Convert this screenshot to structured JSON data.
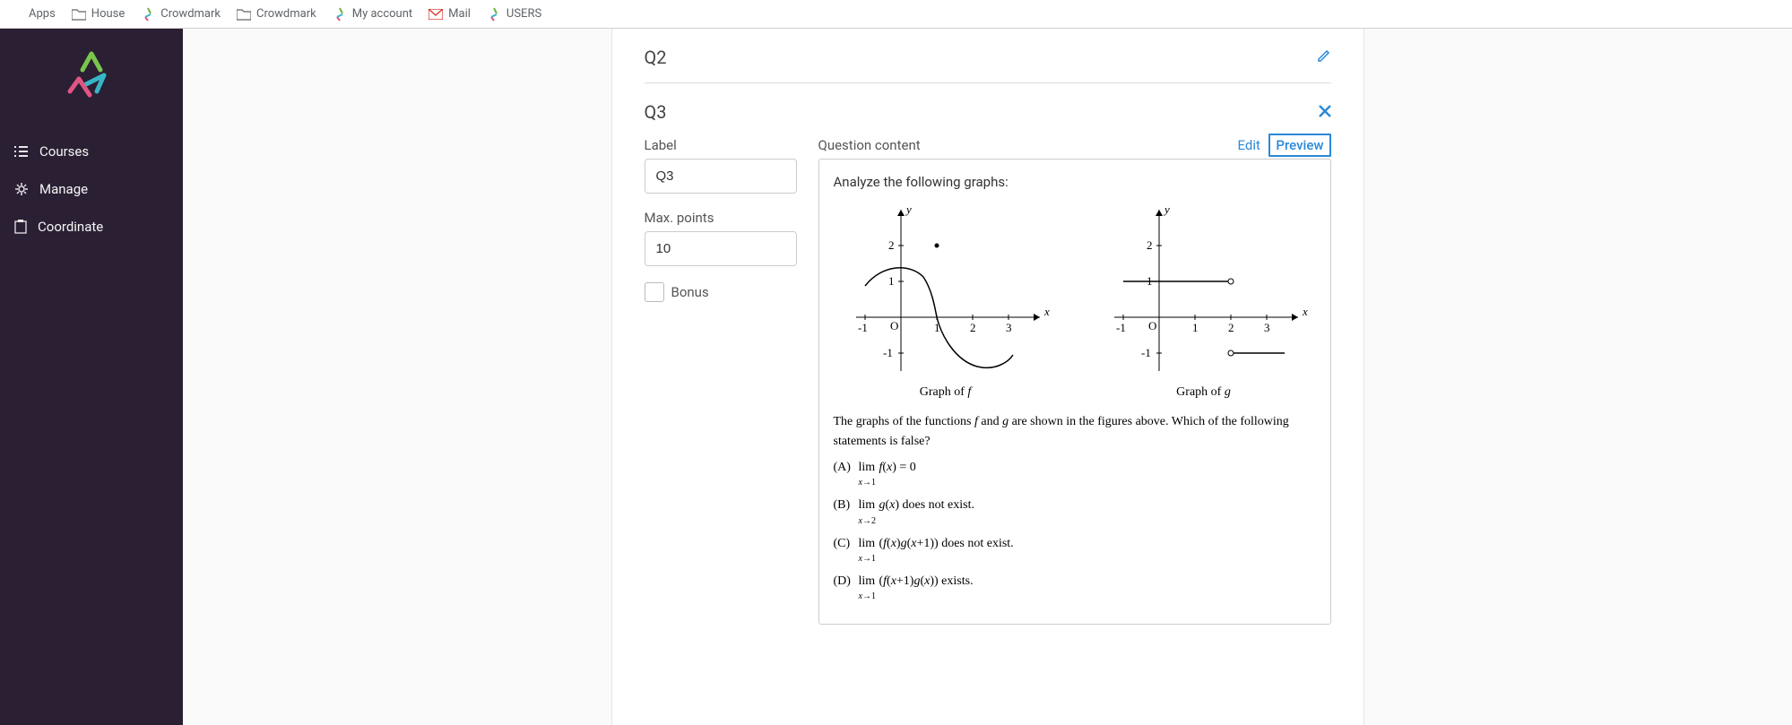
{
  "bookmarks": [
    {
      "label": "Apps",
      "icon": "apps-grid"
    },
    {
      "label": "House",
      "icon": "folder"
    },
    {
      "label": "Crowdmark",
      "icon": "crowdmark"
    },
    {
      "label": "Crowdmark",
      "icon": "folder"
    },
    {
      "label": "My account",
      "icon": "crowdmark"
    },
    {
      "label": "Mail",
      "icon": "gmail"
    },
    {
      "label": "USERS",
      "icon": "crowdmark"
    }
  ],
  "sidebar": {
    "items": [
      {
        "label": "Courses",
        "icon": "list"
      },
      {
        "label": "Manage",
        "icon": "gear"
      },
      {
        "label": "Coordinate",
        "icon": "clipboard"
      }
    ]
  },
  "q2": {
    "title": "Q2"
  },
  "q3": {
    "title": "Q3",
    "form": {
      "label_label": "Label",
      "label_value": "Q3",
      "points_label": "Max. points",
      "points_value": "10",
      "bonus_label": "Bonus",
      "bonus_checked": false
    },
    "content": {
      "heading": "Question content",
      "tab_edit": "Edit",
      "tab_preview": "Preview",
      "active_tab": "Preview",
      "instruction": "Analyze the following graphs:",
      "graph_f_caption": "Graph of f",
      "graph_g_caption": "Graph of g",
      "statement": "The graphs of the functions f and g are shown in the figures above. Which of the following statements is false?",
      "options": [
        {
          "label": "(A)",
          "text": "lim_{x→1} f(x) = 0"
        },
        {
          "label": "(B)",
          "text": "lim_{x→2} g(x) does not exist."
        },
        {
          "label": "(C)",
          "text": "lim_{x→1} (f(x)g(x+1)) does not exist."
        },
        {
          "label": "(D)",
          "text": "lim_{x→1} (f(x+1)g(x)) exists."
        }
      ]
    }
  },
  "chart_data": [
    {
      "type": "line",
      "name": "Graph of f",
      "xlabel": "x",
      "ylabel": "y",
      "xlim": [
        -1,
        3.5
      ],
      "ylim": [
        -1.5,
        2.2
      ],
      "xticks": [
        -1,
        0,
        1,
        2,
        3
      ],
      "yticks": [
        -1,
        1,
        2
      ],
      "origin_label": "O",
      "series": [
        {
          "name": "f continuous curve",
          "kind": "smooth",
          "points": [
            [
              -1,
              0.9
            ],
            [
              -0.4,
              1.3
            ],
            [
              0.2,
              1.4
            ],
            [
              0.7,
              0.8
            ],
            [
              1,
              0
            ],
            [
              1.4,
              -0.7
            ],
            [
              2,
              -1.3
            ],
            [
              2.7,
              -1.35
            ],
            [
              3,
              -1.1
            ]
          ]
        },
        {
          "name": "isolated point",
          "kind": "dot",
          "points": [
            [
              0.5,
              2
            ]
          ]
        }
      ]
    },
    {
      "type": "line",
      "name": "Graph of g",
      "xlabel": "x",
      "ylabel": "y",
      "xlim": [
        -1,
        3.5
      ],
      "ylim": [
        -1.5,
        2.2
      ],
      "xticks": [
        -1,
        0,
        1,
        2,
        3
      ],
      "yticks": [
        -1,
        1,
        2
      ],
      "origin_label": "O",
      "series": [
        {
          "name": "g upper segment",
          "kind": "segment",
          "open_right": true,
          "points": [
            [
              -1,
              1
            ],
            [
              2,
              1
            ]
          ]
        },
        {
          "name": "g lower segment",
          "kind": "segment",
          "open_left": true,
          "points": [
            [
              2,
              -1
            ],
            [
              3.2,
              -1
            ]
          ]
        }
      ]
    }
  ]
}
